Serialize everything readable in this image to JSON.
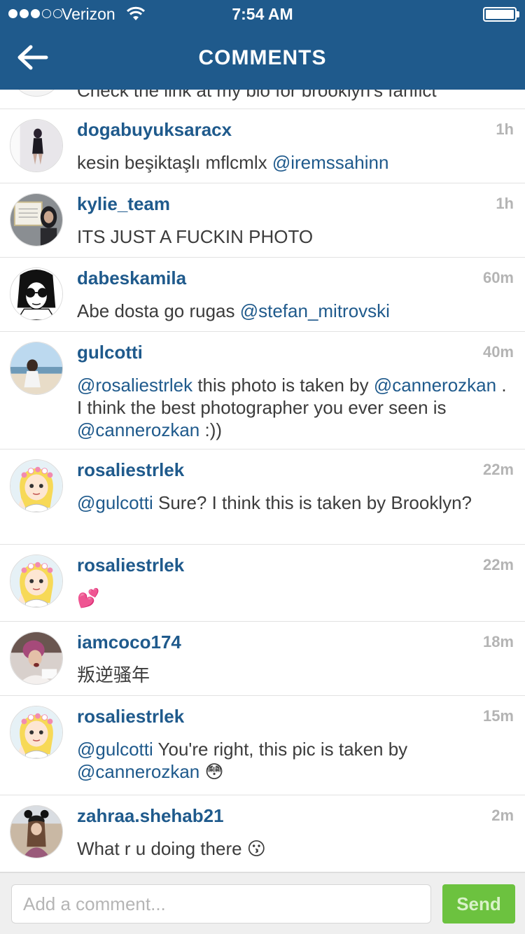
{
  "status_bar": {
    "carrier": "Verizon",
    "time": "7:54 AM",
    "signal_bars": 3,
    "signal_total": 5,
    "battery_level": 1.0
  },
  "nav": {
    "title": "COMMENTS"
  },
  "partial_comment": {
    "text": "Check the link at my bio for brooklyn's fanfict"
  },
  "comments": [
    {
      "user": "dogabuyuksaracx",
      "ago": "1h",
      "parts": [
        {
          "t": "kesin beşiktaşlı mflcmlx "
        },
        {
          "t": "@iremssahinn",
          "m": true
        }
      ]
    },
    {
      "user": "kylie_team",
      "ago": "1h",
      "parts": [
        {
          "t": "ITS JUST A FUCKIN PHOTO"
        }
      ]
    },
    {
      "user": "dabeskamila",
      "ago": "60m",
      "parts": [
        {
          "t": "Abe dosta go rugas "
        },
        {
          "t": "@stefan_mitrovski",
          "m": true
        }
      ]
    },
    {
      "user": "gulcotti",
      "ago": "40m",
      "parts": [
        {
          "t": "@rosaliestrlek",
          "m": true
        },
        {
          "t": " this photo is taken by "
        },
        {
          "t": "@cannerozkan",
          "m": true
        },
        {
          "t": " . I think the best photographer you ever seen is "
        },
        {
          "t": "@cannerozkan",
          "m": true
        },
        {
          "t": " :))"
        }
      ]
    },
    {
      "user": "rosaliestrlek",
      "ago": "22m",
      "parts": [
        {
          "t": "@gulcotti",
          "m": true
        },
        {
          "t": " Sure? I think this is taken by Brooklyn?"
        }
      ]
    },
    {
      "user": "rosaliestrlek",
      "ago": "22m",
      "parts": [
        {
          "t": "💕"
        }
      ]
    },
    {
      "user": "iamcoco174",
      "ago": "18m",
      "parts": [
        {
          "t": "叛逆骚年"
        }
      ]
    },
    {
      "user": "rosaliestrlek",
      "ago": "15m",
      "parts": [
        {
          "t": "@gulcotti",
          "m": true
        },
        {
          "t": " You're right, this pic is taken by "
        },
        {
          "t": "@cannerozkan",
          "m": true
        },
        {
          "t": " 😳"
        }
      ]
    },
    {
      "user": "zahraa.shehab21",
      "ago": "2m",
      "parts": [
        {
          "t": "What r u doing there 😗"
        }
      ]
    }
  ],
  "composer": {
    "placeholder": "Add a comment...",
    "send_label": "Send"
  },
  "colors": {
    "brand": "#1f5a8c",
    "send": "#6cc23f",
    "timestamp": "#b4b4b4"
  }
}
